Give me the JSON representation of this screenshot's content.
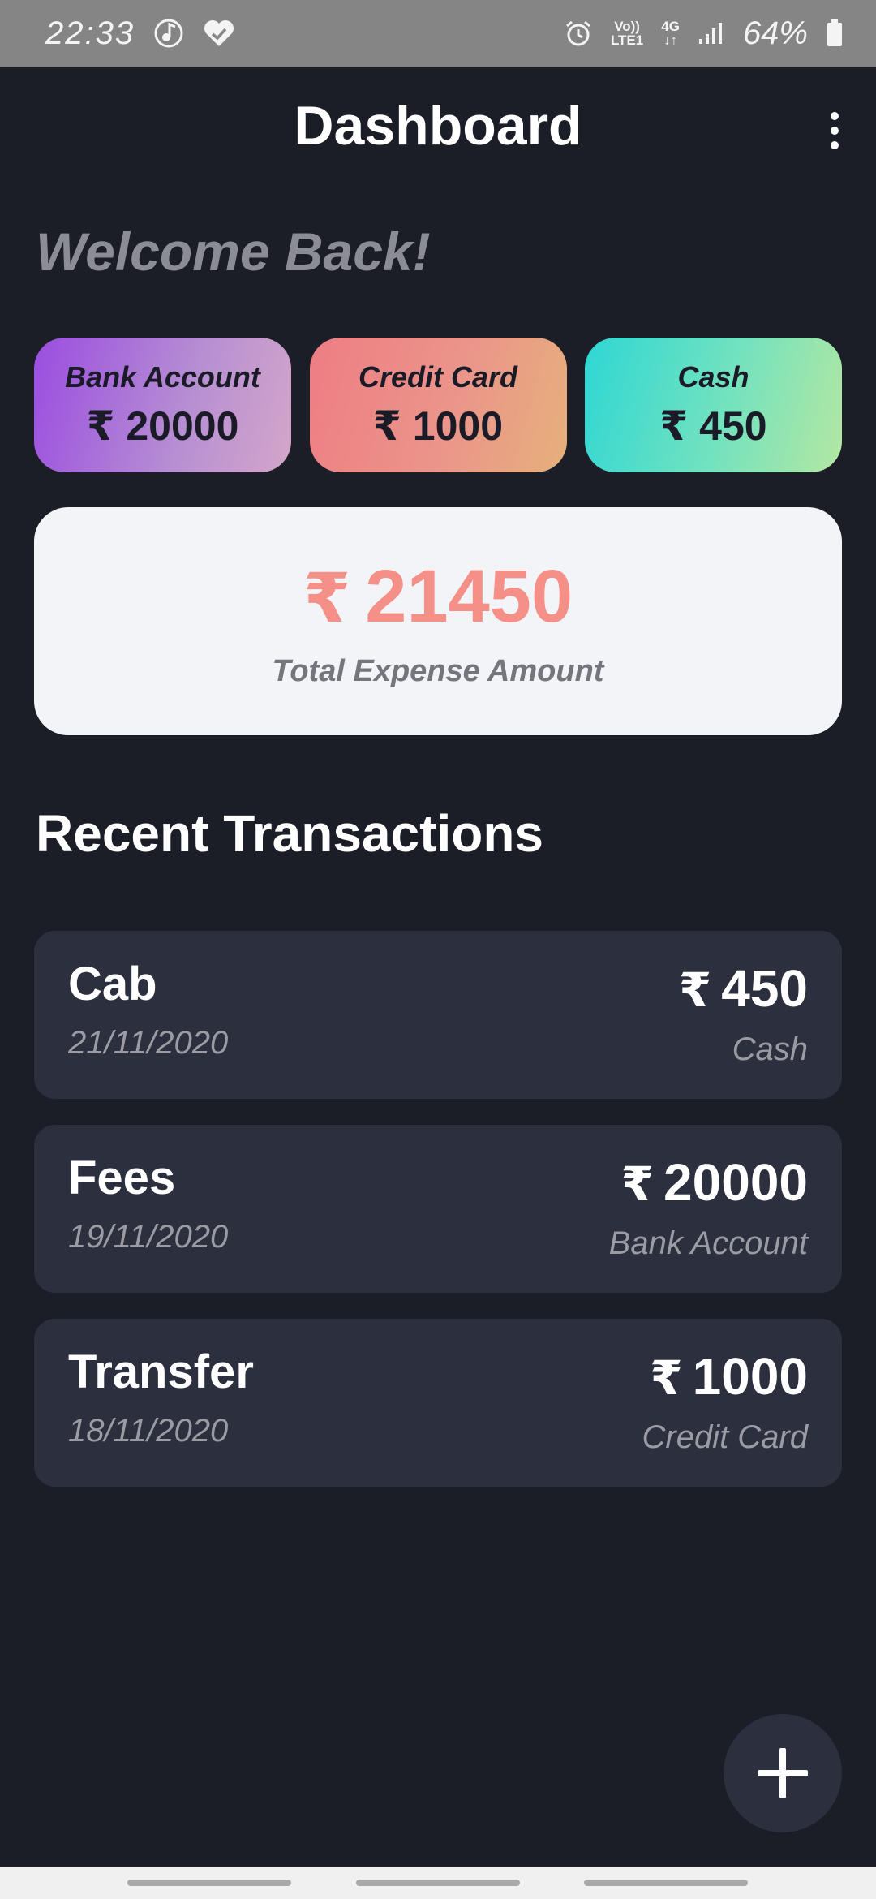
{
  "status_bar": {
    "time": "22:33",
    "network_label_top": "Vo))",
    "network_label_bottom": "LTE1",
    "network_type": "4G",
    "battery": "64%",
    "icons": [
      "music-icon",
      "heart-check-icon",
      "alarm-icon",
      "signal-icon",
      "battery-icon"
    ]
  },
  "app_bar": {
    "title": "Dashboard",
    "menu_icon": "more-vert-icon"
  },
  "welcome": "Welcome Back!",
  "currency": "₹",
  "accounts": [
    {
      "label": "Bank Account",
      "amount": "20000",
      "gradient": [
        "#9a4de0",
        "#d4a6c9"
      ]
    },
    {
      "label": "Credit Card",
      "amount": "1000",
      "gradient": [
        "#ee7d84",
        "#e6b07c"
      ]
    },
    {
      "label": "Cash",
      "amount": "450",
      "gradient": [
        "#2ed7d4",
        "#b4e7a2"
      ]
    }
  ],
  "total": {
    "amount": "21450",
    "label": "Total Expense Amount",
    "color": "#f49088"
  },
  "recent": {
    "title": "Recent Transactions",
    "items": [
      {
        "name": "Cab",
        "date": "21/11/2020",
        "amount": "450",
        "account": "Cash"
      },
      {
        "name": "Fees",
        "date": "19/11/2020",
        "amount": "20000",
        "account": "Bank Account"
      },
      {
        "name": "Transfer",
        "date": "18/11/2020",
        "amount": "1000",
        "account": "Credit Card"
      }
    ]
  },
  "fab_icon": "plus-icon",
  "colors": {
    "background": "#1b1d27",
    "card": "#2c2f3d",
    "total_card": "#f3f4f8",
    "muted_text": "#9a9ba3"
  }
}
